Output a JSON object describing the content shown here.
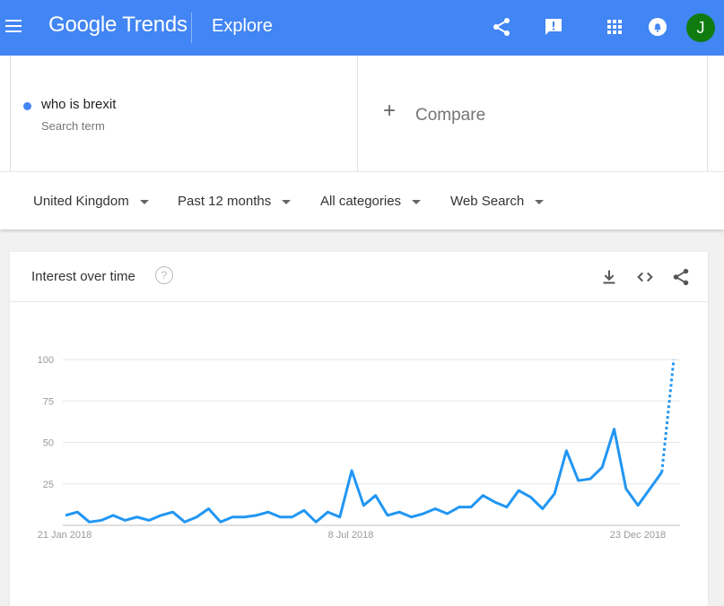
{
  "header": {
    "logo_text": "Google Trends",
    "page_title": "Explore",
    "avatar_initial": "J",
    "icons": [
      "menu-icon",
      "share-icon",
      "feedback-icon",
      "apps-icon",
      "notifications-icon"
    ]
  },
  "search": {
    "term": "who is brexit",
    "term_sublabel": "Search term",
    "compare_plus": "+",
    "compare_label": "Compare",
    "term_color": "#4285f4"
  },
  "filters": [
    {
      "label": "United Kingdom"
    },
    {
      "label": "Past 12 months"
    },
    {
      "label": "All categories"
    },
    {
      "label": "Web Search"
    }
  ],
  "card": {
    "title": "Interest over time",
    "help_icon": "?",
    "icons": [
      "download-icon",
      "embed-icon",
      "share-icon"
    ]
  },
  "colors": {
    "brand": "#4285f4",
    "series": "#2196f3"
  },
  "chart_data": {
    "type": "line",
    "x_tick_labels": [
      "21 Jan 2018",
      "8 Jul 2018",
      "23 Dec 2018"
    ],
    "y_ticks": [
      25,
      50,
      75,
      100
    ],
    "ylim": [
      0,
      100
    ],
    "grid": true,
    "series": [
      {
        "values": [
          6,
          8,
          2,
          3,
          6,
          3,
          5,
          3,
          6,
          8,
          2,
          5,
          10,
          2,
          5,
          5,
          6,
          8,
          5,
          5,
          9,
          2,
          8,
          5,
          33,
          12,
          18,
          6,
          8,
          5,
          7,
          10,
          7,
          11,
          11,
          18,
          14,
          11,
          21,
          17,
          10,
          19,
          45,
          27,
          28,
          35,
          58,
          22,
          12,
          22,
          32,
          100
        ],
        "partial_from_index": 50
      }
    ]
  }
}
